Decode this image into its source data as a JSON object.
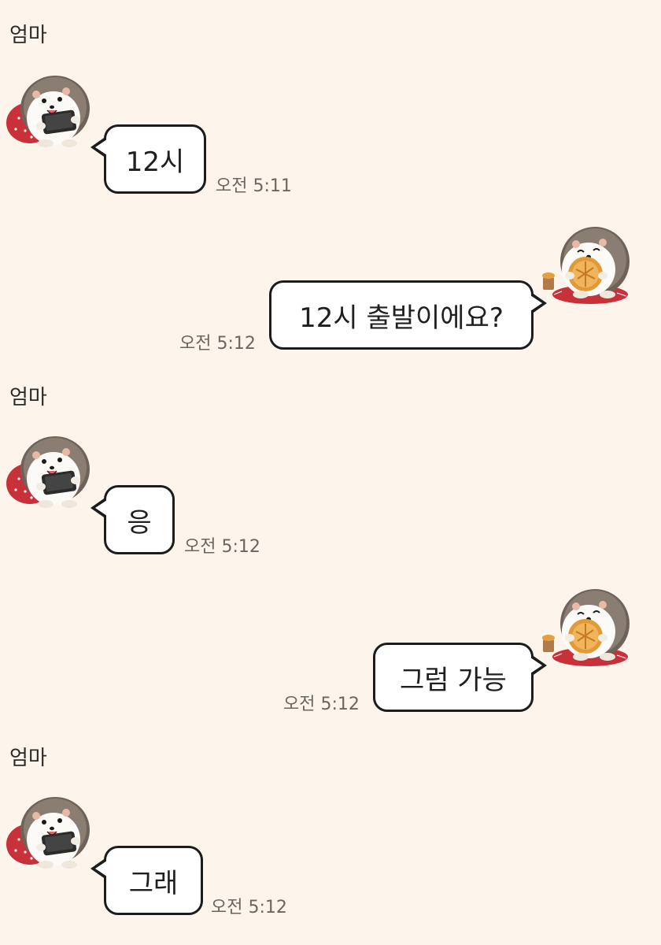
{
  "conversation": {
    "messages": [
      {
        "side": "received",
        "sender": "엄마",
        "text": "12시",
        "time": "오전 5:11"
      },
      {
        "side": "sent",
        "text": "12시 출발이에요?",
        "time": "오전 5:12"
      },
      {
        "side": "received",
        "sender": "엄마",
        "text": "응",
        "time": "오전 5:12"
      },
      {
        "side": "sent",
        "text": "그럼 가능",
        "time": "오전 5:12"
      },
      {
        "side": "received",
        "sender": "엄마",
        "text": "그래",
        "time": "오전 5:12"
      }
    ]
  },
  "avatars": {
    "received": "hedgehog-with-phone-icon",
    "sent": "hedgehog-with-cookie-icon"
  },
  "colors": {
    "background": "#FDF5EC",
    "bubble": "#FFFFFF",
    "bubble_border": "#1C1C1C",
    "timestamp": "#6A6560",
    "cushion": "#C8303A"
  }
}
